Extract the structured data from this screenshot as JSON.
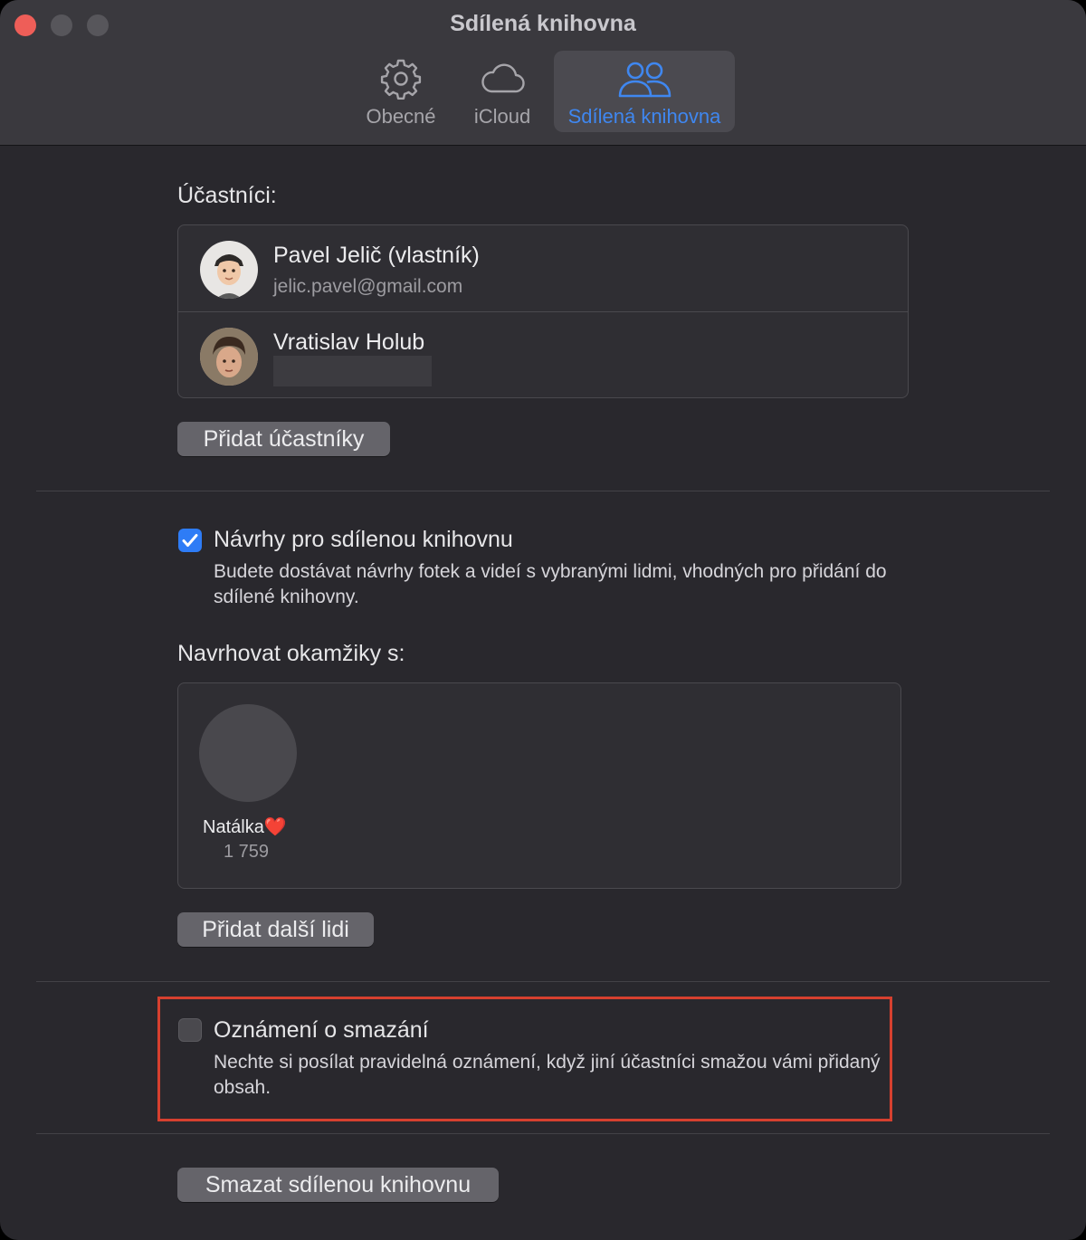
{
  "window": {
    "title": "Sdílená knihovna"
  },
  "tabs": [
    {
      "label": "Obecné",
      "icon": "gear-icon",
      "active": false
    },
    {
      "label": "iCloud",
      "icon": "cloud-icon",
      "active": false
    },
    {
      "label": "Sdílená knihovna",
      "icon": "people-icon",
      "active": true
    }
  ],
  "participants": {
    "heading": "Účastníci:",
    "items": [
      {
        "name": "Pavel Jelič (vlastník)",
        "email": "jelic.pavel@gmail.com"
      },
      {
        "name": "Vratislav Holub",
        "email": ""
      }
    ],
    "add_button": "Přidat účastníky"
  },
  "suggestions": {
    "checkbox_label": "Návrhy pro sdílenou knihovnu",
    "checked": true,
    "description": "Budete dostávat návrhy fotek a videí s vybranými lidmi, vhodných pro přidání do sdílené knihovny."
  },
  "moments": {
    "heading": "Navrhovat okamžiky s:",
    "people": [
      {
        "name": "Natálka",
        "emoji": "❤️",
        "count": "1 759"
      }
    ],
    "add_button": "Přidat další lidi"
  },
  "deletion": {
    "checkbox_label": "Oznámení o smazání",
    "checked": false,
    "description": "Nechte si posílat pravidelná oznámení, když jiní účastníci smažou vámi přidaný obsah."
  },
  "delete_button": "Smazat sdílenou knihovnu",
  "colors": {
    "accent": "#2e7cf6",
    "active_tab_text": "#3f87f0",
    "highlight_border": "#d6402f",
    "close_button": "#ee5e58"
  }
}
